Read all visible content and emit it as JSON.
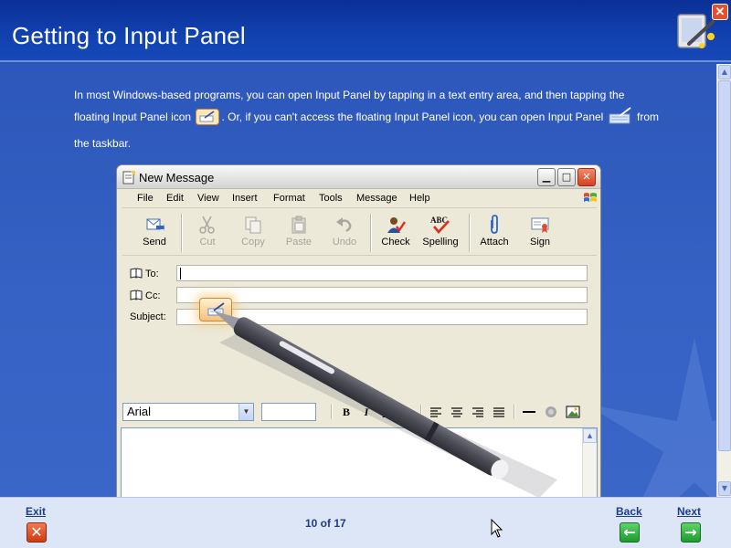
{
  "header": {
    "title": "Getting to Input Panel"
  },
  "intro": {
    "part1": "In most Windows-based programs, you can open Input Panel by tapping in a text entry area, and then tapping the floating Input Panel icon",
    "part2": ". Or, if you can't access the floating Input Panel icon, you can open Input Panel",
    "part3": "from the taskbar."
  },
  "window": {
    "title": "New Message",
    "menu": [
      "File",
      "Edit",
      "View",
      "Insert",
      "Format",
      "Tools",
      "Message",
      "Help"
    ],
    "toolbar": {
      "send": "Send",
      "cut": "Cut",
      "copy": "Copy",
      "paste": "Paste",
      "undo": "Undo",
      "check": "Check",
      "spelling": "Spelling",
      "attach": "Attach",
      "sign": "Sign"
    },
    "fields": {
      "to_label": "To:",
      "cc_label": "Cc:",
      "subject_label": "Subject:"
    },
    "format": {
      "font": "Arial",
      "bold": "B",
      "italic": "I",
      "underline": "U"
    }
  },
  "footer": {
    "exit": "Exit",
    "back": "Back",
    "next": "Next",
    "page": "10 of 17"
  },
  "colors": {
    "header_bg": "#1142b0",
    "content_bg": "#3562c4",
    "footer_bg": "#dde6f7",
    "nav_green": "#1e9a2c",
    "exit_red": "#d03a10"
  }
}
